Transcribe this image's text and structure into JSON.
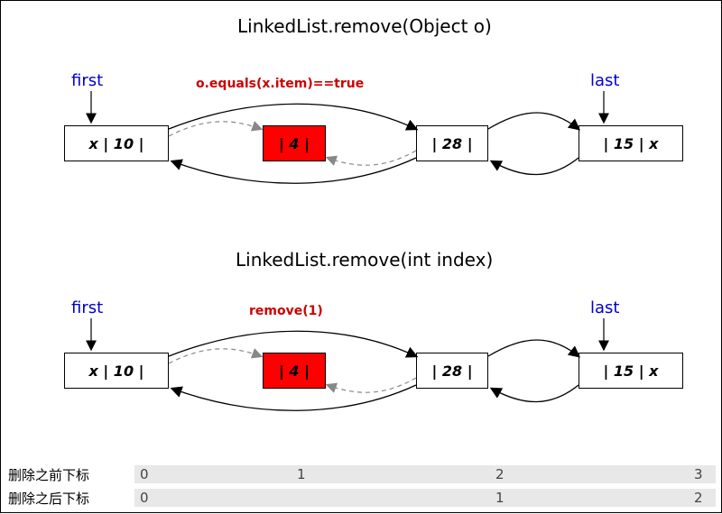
{
  "titles": {
    "top": "LinkedList.remove(Object o)",
    "bottom": "LinkedList.remove(int index)"
  },
  "pointers": {
    "first": "first",
    "last": "last"
  },
  "conditions": {
    "top": "o.equals(x.item)==true",
    "bottom": "remove(1)"
  },
  "nodes": {
    "n0": "x | 10 |",
    "n1": "| 4 |",
    "n2": "| 28 |",
    "n3": "| 15 | x"
  },
  "indexRows": {
    "before": {
      "label": "删除之前下标",
      "values": [
        "0",
        "1",
        "2",
        "3"
      ]
    },
    "after": {
      "label": "删除之后下标",
      "values": [
        "0",
        "1",
        "2"
      ]
    }
  }
}
